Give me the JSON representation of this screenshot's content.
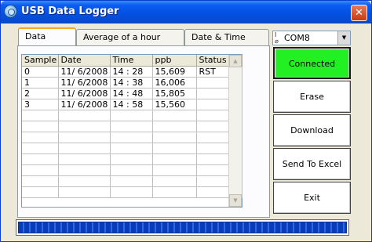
{
  "window": {
    "title": "USB Data Logger",
    "close_glyph": "✕"
  },
  "tabs": [
    {
      "label": "Data",
      "active": true
    },
    {
      "label": "Average of a hour",
      "active": false
    },
    {
      "label": "Date & Time",
      "active": false
    }
  ],
  "grid": {
    "columns": [
      "Sample",
      "Date",
      "Time",
      "ppb",
      "Status"
    ],
    "rows": [
      [
        "0",
        "11/ 6/2008",
        "14 : 28",
        "15,609",
        "RST"
      ],
      [
        "1",
        "11/ 6/2008",
        "14 : 38",
        "16,006",
        ""
      ],
      [
        "2",
        "11/ 6/2008",
        "14 : 48",
        "15,805",
        ""
      ],
      [
        "3",
        "11/ 6/2008",
        "14 : 58",
        "15,560",
        ""
      ]
    ],
    "empty_rows": 8
  },
  "port": {
    "value": "COM8",
    "icon": "serial-port-icon"
  },
  "buttons": {
    "connected": "Connected",
    "erase": "Erase",
    "download": "Download",
    "send_to_excel": "Send To Excel",
    "exit": "Exit"
  },
  "progress": {
    "value": 1.0
  },
  "colors": {
    "connected_bg": "#22f022",
    "titlebar": "#0350e0",
    "progress": "#0a3cb8"
  }
}
